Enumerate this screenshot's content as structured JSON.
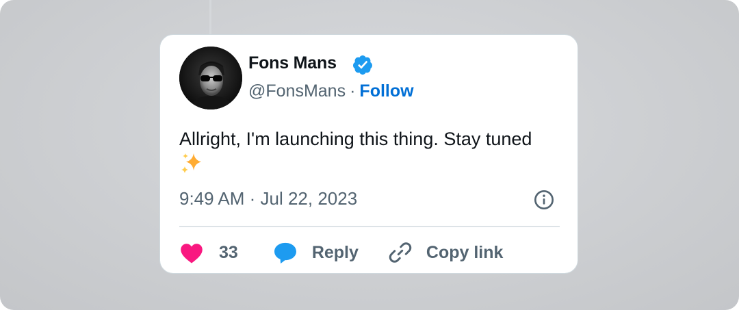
{
  "tweet": {
    "author_name": "Fons Mans",
    "handle": "@FonsMans",
    "separator": "·",
    "follow_label": "Follow",
    "text": "Allright, I'm launching this thing. Stay tuned",
    "emoji": "✨",
    "timestamp": "9:49 AM · Jul 22, 2023",
    "verified": true,
    "likes": "33",
    "reply_label": "Reply",
    "copy_link_label": "Copy link"
  },
  "icons": {
    "verified": "verified-badge-icon",
    "info": "info-icon",
    "like": "heart-icon",
    "reply": "speech-bubble-icon",
    "copy": "link-icon"
  },
  "colors": {
    "link": "#006fd6",
    "verified": "#1d9bf0",
    "heart": "#f91880",
    "reply_bubble": "#1d9bf0",
    "secondary_text": "#536471",
    "primary_text": "#0f1419"
  }
}
